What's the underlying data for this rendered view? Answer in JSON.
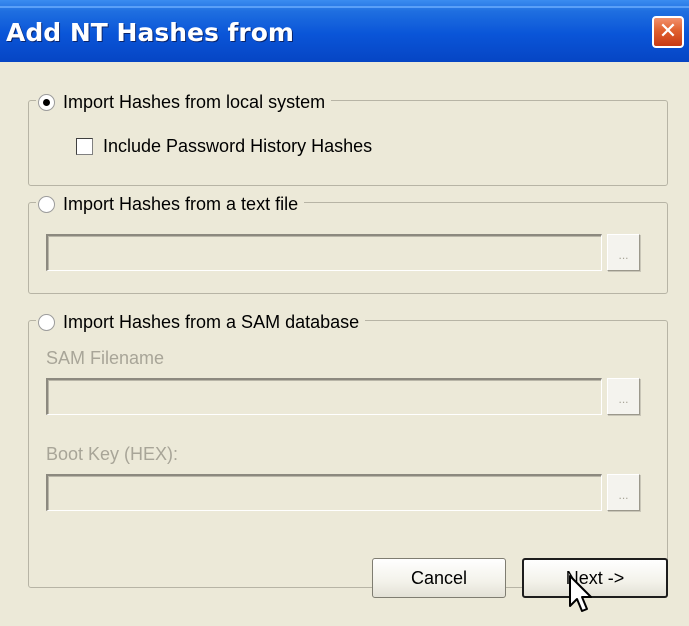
{
  "window": {
    "title": "Add NT Hashes from",
    "close_glyph": "✕"
  },
  "options": {
    "local_system": {
      "label": "Import Hashes from local system",
      "selected": true,
      "include_history_label": "Include Password History Hashes",
      "include_history_checked": false
    },
    "text_file": {
      "label": "Import Hashes from a text file",
      "selected": false,
      "file_value": "",
      "browse_label": "..."
    },
    "sam_database": {
      "label": "Import Hashes from a SAM database",
      "selected": false,
      "sam_filename_label": "SAM Filename",
      "sam_filename_value": "",
      "boot_key_label": "Boot Key (HEX):",
      "boot_key_value": "",
      "browse_label": "..."
    }
  },
  "buttons": {
    "cancel": "Cancel",
    "next": "Next ->"
  },
  "icons": {
    "close": "close-icon",
    "cursor": "arrow-cursor-icon"
  },
  "colors": {
    "titlebar": "#0a55d8",
    "close_button": "#e0602e",
    "dialog_background": "#ece9d8",
    "disabled_text": "#a8a598"
  }
}
